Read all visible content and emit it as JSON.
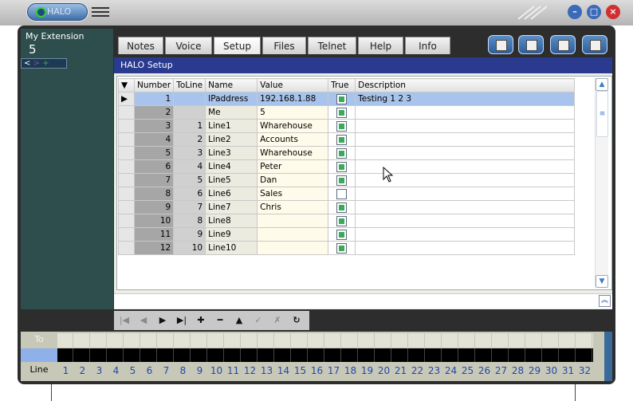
{
  "app": {
    "logo_text": "HALO"
  },
  "left_panel": {
    "extension_label": "My Extension",
    "extension_value": "5",
    "nav": [
      "<",
      ">",
      "+"
    ]
  },
  "tabs": [
    {
      "label": "Notes",
      "active": false
    },
    {
      "label": "Voice",
      "active": false
    },
    {
      "label": "Setup",
      "active": true
    },
    {
      "label": "Files",
      "active": false
    },
    {
      "label": "Telnet",
      "active": false
    },
    {
      "label": "Help",
      "active": false
    },
    {
      "label": "Info",
      "active": false
    }
  ],
  "setup": {
    "header": "HALO Setup",
    "columns": [
      "Number",
      "ToLine",
      "Name",
      "Value",
      "True",
      "Description"
    ],
    "rows": [
      {
        "number": "1",
        "toline": "",
        "name": "IPaddress",
        "value": "192.168.1.88",
        "true": true,
        "description": "Testing 1  2 3",
        "selected": true
      },
      {
        "number": "2",
        "toline": "",
        "name": "Me",
        "value": "5",
        "true": true,
        "description": ""
      },
      {
        "number": "3",
        "toline": "1",
        "name": "Line1",
        "value": "Wharehouse",
        "true": true,
        "description": ""
      },
      {
        "number": "4",
        "toline": "2",
        "name": "Line2",
        "value": "Accounts",
        "true": true,
        "description": ""
      },
      {
        "number": "5",
        "toline": "3",
        "name": "Line3",
        "value": "Wharehouse",
        "true": true,
        "description": ""
      },
      {
        "number": "6",
        "toline": "4",
        "name": "Line4",
        "value": "Peter",
        "true": true,
        "description": ""
      },
      {
        "number": "7",
        "toline": "5",
        "name": "Line5",
        "value": "Dan",
        "true": true,
        "description": ""
      },
      {
        "number": "8",
        "toline": "6",
        "name": "Line6",
        "value": "Sales",
        "true": false,
        "description": ""
      },
      {
        "number": "9",
        "toline": "7",
        "name": "Line7",
        "value": "Chris",
        "true": true,
        "description": ""
      },
      {
        "number": "10",
        "toline": "8",
        "name": "Line8",
        "value": "",
        "true": true,
        "description": ""
      },
      {
        "number": "11",
        "toline": "9",
        "name": "Line9",
        "value": "",
        "true": true,
        "description": ""
      },
      {
        "number": "12",
        "toline": "10",
        "name": "Line10",
        "value": "",
        "true": true,
        "description": ""
      }
    ]
  },
  "bottom": {
    "to_label": "To",
    "line_label": "Line",
    "lines": [
      "1",
      "2",
      "3",
      "4",
      "5",
      "6",
      "7",
      "8",
      "9",
      "10",
      "11",
      "12",
      "13",
      "14",
      "15",
      "16",
      "17",
      "18",
      "19",
      "20",
      "21",
      "22",
      "23",
      "24",
      "25",
      "26",
      "27",
      "28",
      "29",
      "30",
      "31",
      "32"
    ]
  },
  "colors": {
    "header_bg": "#2a3a8e",
    "selected_row": "#a9c4ec",
    "check_green": "#3aaa5a",
    "line_number": "#1e4aa8"
  }
}
